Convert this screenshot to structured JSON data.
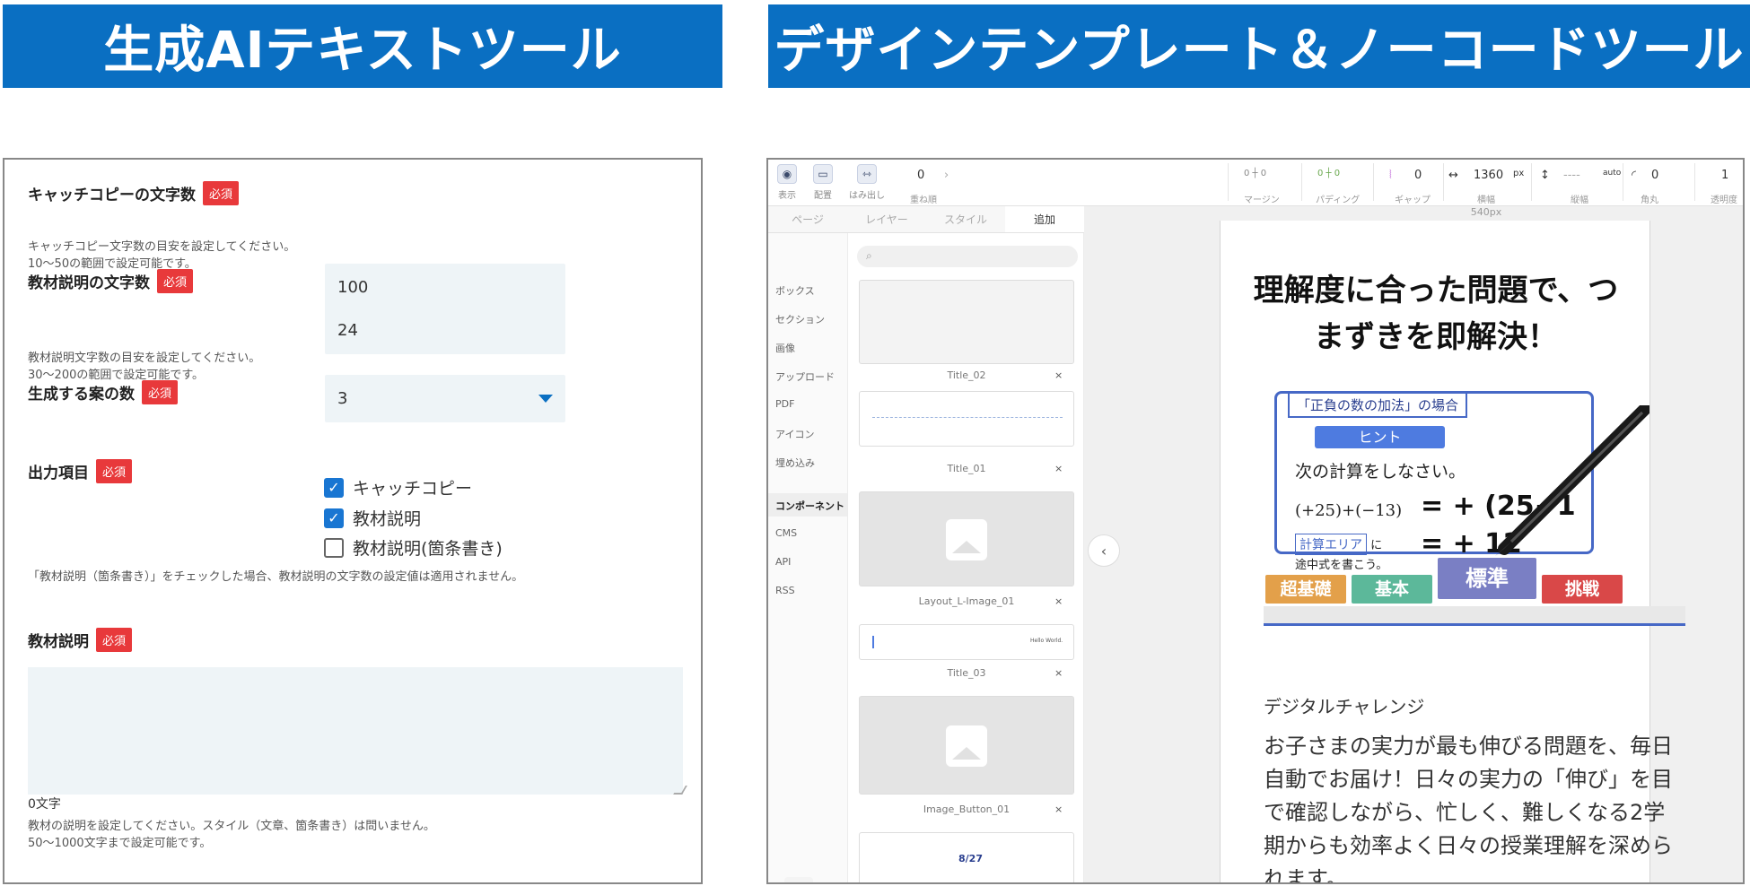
{
  "banners": {
    "left": "生成AIテキストツール",
    "right": "デザインテンプレート＆ノーコードツール"
  },
  "form": {
    "required_badge": "必須",
    "catch_chars": {
      "label": "キャッチコピーの文字数",
      "value": "24",
      "help1": "キャッチコピー文字数の目安を設定してください。",
      "help2": "10〜50の範囲で設定可能です。"
    },
    "material_chars": {
      "label": "教材説明の文字数",
      "value": "100",
      "help1": "教材説明文字数の目安を設定してください。",
      "help2": "30〜200の範囲で設定可能です。"
    },
    "proposal_count": {
      "label": "生成する案の数",
      "value": "3"
    },
    "output_items": {
      "label": "出力項目",
      "options": [
        {
          "label": "キャッチコピー",
          "checked": true
        },
        {
          "label": "教材説明",
          "checked": true
        },
        {
          "label": "教材説明(箇条書き)",
          "checked": false
        }
      ],
      "check_mark": "✓",
      "note": "「教材説明（箇条書き）」をチェックした場合、教材説明の文字数の設定値は適用されません。"
    },
    "material_desc": {
      "label": "教材説明",
      "value": "",
      "count": "0文字",
      "help1": "教材の説明を設定してください。スタイル（文章、箇条書き）は問いません。",
      "help2": "50〜1000文字まで設定可能です。"
    }
  },
  "editor": {
    "toolbar": {
      "view": "表示",
      "layout": "配置",
      "overflow": "はみ出し",
      "stack_value": "0",
      "stack": "重ね順",
      "margin": "マージン",
      "padding": "パディング",
      "gap_value": "0",
      "gap": "ギャップ",
      "width_value": "1360",
      "width_unit": "px",
      "width": "横幅",
      "height_value": "----",
      "height_unit": "auto",
      "height": "縦幅",
      "radius_value": "0",
      "radius": "角丸",
      "opacity_value": "1",
      "opacity": "透明度",
      "zero": "0"
    },
    "tabs": [
      "ページ",
      "レイヤー",
      "スタイル",
      "追加"
    ],
    "nav": [
      "ボックス",
      "セクション",
      "画像",
      "アップロード",
      "PDF",
      "アイコン",
      "埋め込み",
      "コンポーネント",
      "CMS",
      "API",
      "RSS"
    ],
    "components": [
      {
        "name": "Title_02",
        "close": "×"
      },
      {
        "name": "Title_01",
        "close": "×"
      },
      {
        "name": "Layout_L-Image_01",
        "close": "×"
      },
      {
        "name": "Title_03",
        "close": "×",
        "preview": "Hello World."
      },
      {
        "name": "Image_Button_01",
        "close": "×"
      }
    ],
    "partial_thumb_date": "8/27",
    "collapse": "‹",
    "canvas_width_label": "540px",
    "canvas": {
      "headline": "理解度に合った問題で、つまずきを即解決！",
      "figure": {
        "tag": "「正負の数の加法」の場合",
        "hint": "ヒント",
        "instruction": "次の計算をしなさい。",
        "equation": "(+25)+(−13)",
        "handwritten1": "= + (25−1",
        "area_tag": "計算エリア",
        "area_suffix": "に",
        "area_text": "途中式を書こう。",
        "handwritten2": "= + 12",
        "levels": [
          "超基礎",
          "基本",
          "標準",
          "挑戦"
        ]
      },
      "caption": "デジタルチャレンジ",
      "body": "お子さまの実力が最も伸びる問題を、毎日自動でお届け！日々の実力の「伸び」を目で確認しながら、忙しく、難しくなる2学期からも効率よく日々の授業理解を深められます。"
    },
    "colors": {
      "accent": "#0a6fc2",
      "required": "#e8393b",
      "figure_border": "#4668c6"
    }
  }
}
